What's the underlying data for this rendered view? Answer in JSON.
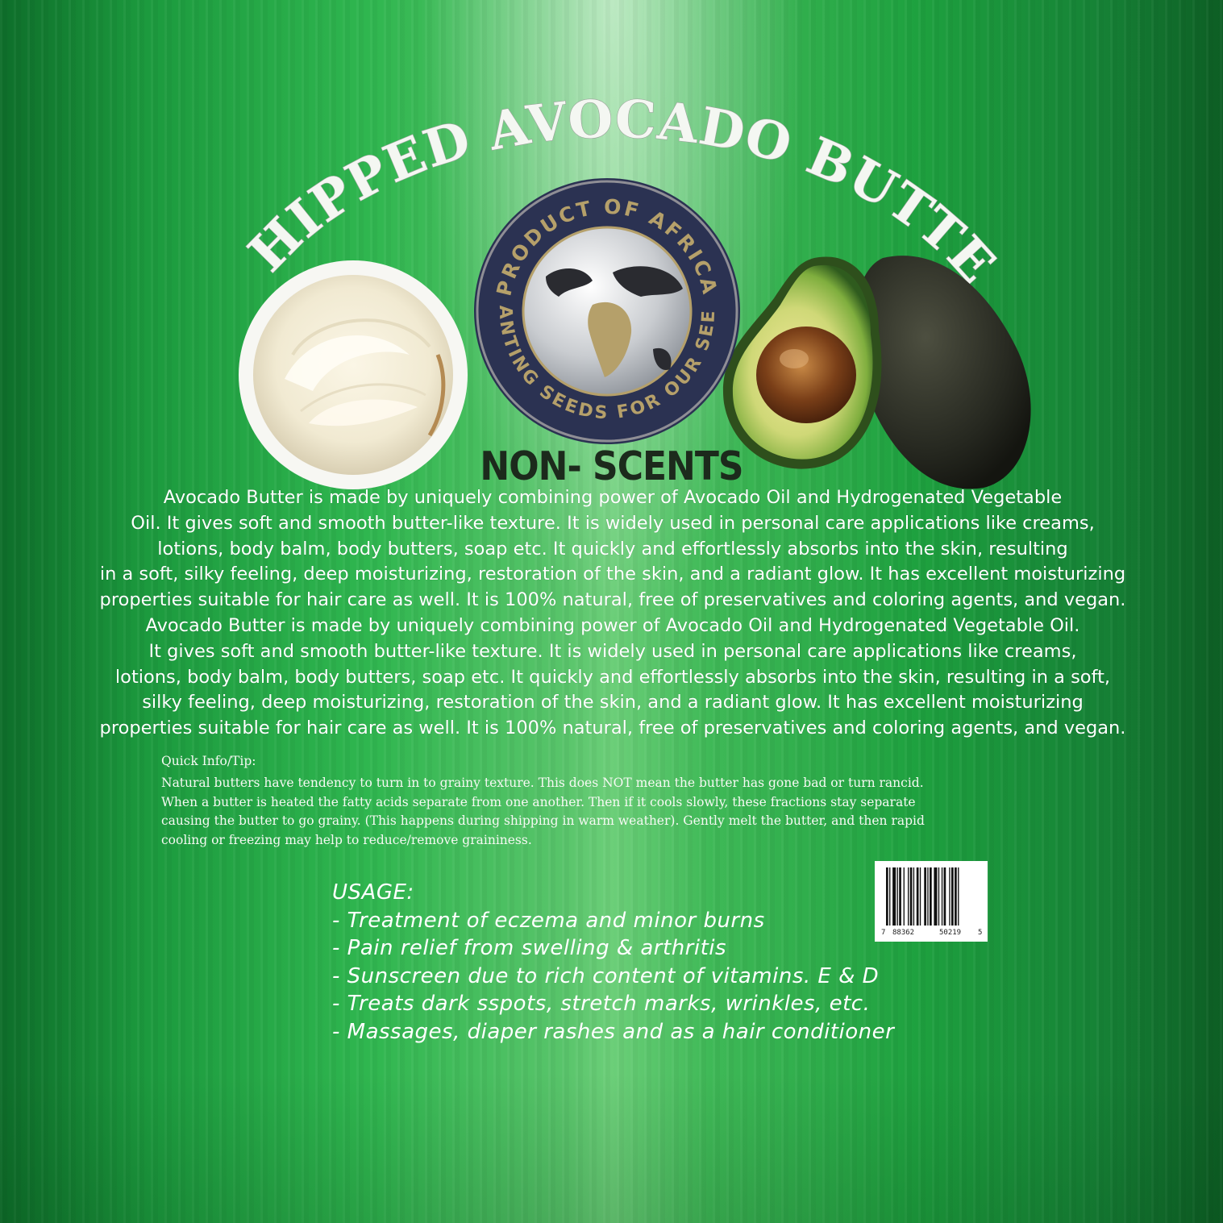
{
  "title": "WHIPPED AVOCADO BUTTER",
  "seal": {
    "top_text": "PRODUCT OF AFRICA",
    "bottom_text": "PLANTING SEEDS FOR OUR SEEDS"
  },
  "scent": "NON- SCENTS",
  "description_lines": [
    "Avocado Butter is made by uniquely combining power of Avocado Oil and Hydrogenated Vegetable",
    "Oil. It gives soft and smooth butter-like texture.  It is widely used in personal care applications like creams,",
    "lotions, body balm, body butters, soap etc. It quickly and effortlessly absorbs into the skin, resulting",
    "in a soft, silky feeling, deep moisturizing,  restoration of the skin, and a radiant glow. It has excellent moisturizing",
    "properties suitable for hair care as well. It is 100% natural, free of  preservatives and coloring agents, and vegan.",
    "Avocado Butter is made by  uniquely combining power of Avocado Oil and Hydrogenated Vegetable Oil.",
    "It gives soft and smooth butter-like texture. It is widely used in personal care  applications like creams,",
    "lotions, body balm, body butters, soap etc. It  quickly and effortlessly absorbs into the skin, resulting in a soft,",
    "silky feeling,  deep moisturizing, restoration of the skin, and a radiant glow. It has excellent  moisturizing",
    "properties suitable for hair care as well. It is 100% natural, free of preservatives and coloring agents, and vegan."
  ],
  "tip": {
    "title": "Quick Info/Tip:",
    "lines": [
      "Natural butters have tendency to turn in to grainy texture. This does NOT mean the butter has gone bad or turn rancid.",
      "When a butter is heated the fatty acids separate from one another. Then if it cools slowly, these fractions stay separate",
      "causing the butter to go grainy. (This happens during shipping in warm weather). Gently melt the butter, and then rapid",
      "cooling or freezing may help to reduce/remove graininess."
    ]
  },
  "usage": {
    "heading": "USAGE:",
    "items": [
      "- Treatment of eczema and minor burns",
      "- Pain relief from swelling & arthritis",
      "- Sunscreen due to rich content of vitamins. E & D",
      "- Treats dark sspots, stretch marks, wrinkles, etc.",
      "- Massages, diaper rashes and as a hair conditioner"
    ]
  },
  "barcode": {
    "digits": [
      "7",
      "88362",
      "50219",
      "5"
    ]
  },
  "colors": {
    "background_green": "#1fa640",
    "text_white": "#ffffff",
    "seal_navy": "#2a3150",
    "seal_gold": "#b5a06a"
  }
}
